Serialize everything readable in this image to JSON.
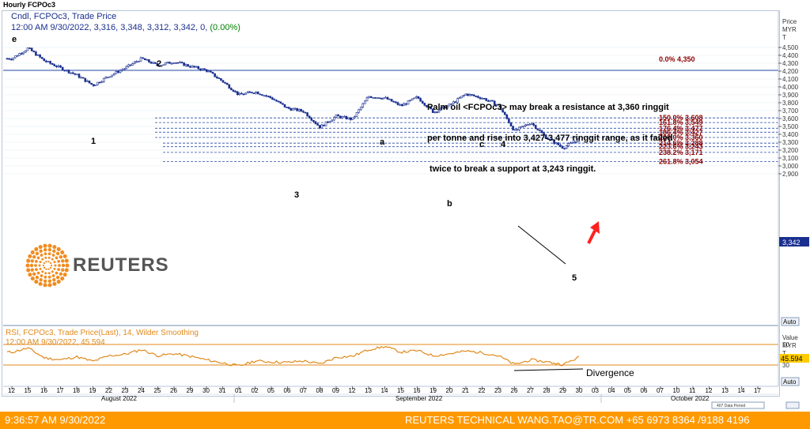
{
  "window": {
    "title": "Hourly FCPOc3"
  },
  "header": {
    "line1": "Cndl, FCPOc3, Trade Price",
    "line2_prefix": "12:00 AM 9/30/2022, 3,316, 3,348, 3,312, 3,342, 0, ",
    "line2_change": "(0.00%)"
  },
  "annotation": {
    "lines": [
      "Palm oil <FCPOc3> may break a resistance at 3,360 ringgit",
      "per tonne and rise into 3,427-3,477 ringgit range, as it failed",
      " twice to break a support at 3,243 ringgit."
    ]
  },
  "price_axis": {
    "title_lines": [
      "Price",
      "MYR",
      "T"
    ],
    "ticks": [
      "4,500",
      "4,400",
      "4,300",
      "4,200",
      "4,100",
      "4,000",
      "3,900",
      "3,800",
      "3,700",
      "3,600",
      "3,500",
      "3,400",
      "3,300",
      "3,200",
      "3,100",
      "3,000",
      "2,900"
    ],
    "current_value": "3,342",
    "auto_label": "Auto"
  },
  "rsi_axis": {
    "title_lines": [
      "Value",
      "MYR",
      "T"
    ],
    "ticks": [
      "70",
      "30"
    ],
    "current_value": "45.594",
    "auto_label": "Auto"
  },
  "rsi_header": {
    "line1": "RSI, FCPOc3, Trade Price(Last),  14, Wilder Smoothing",
    "line2": "12:00 AM 9/30/2022, 45.594"
  },
  "date_axis": {
    "days": [
      "12",
      "15",
      "16",
      "17",
      "18",
      "19",
      "22",
      "23",
      "24",
      "25",
      "26",
      "29",
      "30",
      "31",
      "01",
      "02",
      "05",
      "06",
      "07",
      "08",
      "09",
      "12",
      "13",
      "14",
      "15",
      "16",
      "19",
      "20",
      "21",
      "22",
      "23",
      "26",
      "27",
      "28",
      "29",
      "30",
      "03",
      "04",
      "05",
      "06",
      "07",
      "10",
      "11",
      "12",
      "13",
      "14",
      "17"
    ],
    "months": [
      "August 2022",
      "September 2022",
      "October 2022"
    ],
    "periods_label": "407 Data Period"
  },
  "waves": [
    "e",
    "2",
    "1",
    "3",
    "a",
    "b",
    "c",
    "4",
    "5"
  ],
  "divergence_label": "Divergence",
  "fib_levels": [
    {
      "label": "0.0%",
      "value": "4,350"
    },
    {
      "label": "150.0%",
      "value": "3,608"
    },
    {
      "label": "161.8%",
      "value": "3,549"
    },
    {
      "label": "176.4%",
      "value": "3,477"
    },
    {
      "label": "186.4%",
      "value": "3,427"
    },
    {
      "label": "200.0%",
      "value": "3,360"
    },
    {
      "label": "214.6%",
      "value": "3,288"
    },
    {
      "label": "223.6%",
      "value": "3,243"
    },
    {
      "label": "238.2%",
      "value": "3,171"
    },
    {
      "label": "261.8%",
      "value": "3,054"
    }
  ],
  "logo": {
    "text": "REUTERS"
  },
  "footer": {
    "timestamp": "9:36:57 AM 9/30/2022",
    "contact": "REUTERS TECHNICAL  WANG.TAO@TR.COM  +65 6973 8364 /9188 4196"
  },
  "colors": {
    "candle": "#1a2f8f",
    "fib_line": "#2b4fa8",
    "fib_text": "#8b0000",
    "rsi_line": "#e08a1c",
    "arrow": "#ff2020",
    "footer_bg": "#ff9900",
    "change_green": "#008000"
  },
  "chart_data": [
    {
      "type": "candlestick",
      "title": "Hourly FCPOc3",
      "ylabel": "Price MYR T",
      "ylim": [
        2850,
        4580
      ],
      "x_range": [
        "2022-08-12",
        "2022-10-17"
      ],
      "path_points": [
        {
          "date": "2022-08-12",
          "price": 4360
        },
        {
          "date": "2022-08-15",
          "price": 4490
        },
        {
          "date": "2022-08-16",
          "price": 4330
        },
        {
          "date": "2022-08-17",
          "price": 4240
        },
        {
          "date": "2022-08-18",
          "price": 4150
        },
        {
          "date": "2022-08-19",
          "price": 4020
        },
        {
          "date": "2022-08-22",
          "price": 4140
        },
        {
          "date": "2022-08-23",
          "price": 4240
        },
        {
          "date": "2022-08-24",
          "price": 4360
        },
        {
          "date": "2022-08-25",
          "price": 4270
        },
        {
          "date": "2022-08-26",
          "price": 4320
        },
        {
          "date": "2022-08-29",
          "price": 4260
        },
        {
          "date": "2022-08-30",
          "price": 4210
        },
        {
          "date": "2022-08-31",
          "price": 4070
        },
        {
          "date": "2022-09-01",
          "price": 3900
        },
        {
          "date": "2022-09-02",
          "price": 3940
        },
        {
          "date": "2022-09-05",
          "price": 3860
        },
        {
          "date": "2022-09-06",
          "price": 3730
        },
        {
          "date": "2022-09-07",
          "price": 3690
        },
        {
          "date": "2022-09-08",
          "price": 3490
        },
        {
          "date": "2022-09-09",
          "price": 3630
        },
        {
          "date": "2022-09-12",
          "price": 3590
        },
        {
          "date": "2022-09-13",
          "price": 3880
        },
        {
          "date": "2022-09-14",
          "price": 3860
        },
        {
          "date": "2022-09-15",
          "price": 3760
        },
        {
          "date": "2022-09-16",
          "price": 3870
        },
        {
          "date": "2022-09-19",
          "price": 3680
        },
        {
          "date": "2022-09-20",
          "price": 3770
        },
        {
          "date": "2022-09-21",
          "price": 3910
        },
        {
          "date": "2022-09-22",
          "price": 3860
        },
        {
          "date": "2022-09-23",
          "price": 3770
        },
        {
          "date": "2022-09-26",
          "price": 3440
        },
        {
          "date": "2022-09-27",
          "price": 3550
        },
        {
          "date": "2022-09-28",
          "price": 3350
        },
        {
          "date": "2022-09-29",
          "price": 3230
        },
        {
          "date": "2022-09-30",
          "price": 3342
        }
      ]
    },
    {
      "type": "line",
      "title": "RSI, FCPOc3, Trade Price(Last),  14, Wilder Smoothing",
      "ylim": [
        10,
        90
      ],
      "levels": [
        70,
        30
      ],
      "points": [
        {
          "date": "2022-08-12",
          "rsi": 55
        },
        {
          "date": "2022-08-15",
          "rsi": 63
        },
        {
          "date": "2022-08-16",
          "rsi": 44
        },
        {
          "date": "2022-08-17",
          "rsi": 40
        },
        {
          "date": "2022-08-18",
          "rsi": 46
        },
        {
          "date": "2022-08-19",
          "rsi": 37
        },
        {
          "date": "2022-08-22",
          "rsi": 48
        },
        {
          "date": "2022-08-23",
          "rsi": 51
        },
        {
          "date": "2022-08-24",
          "rsi": 60
        },
        {
          "date": "2022-08-25",
          "rsi": 48
        },
        {
          "date": "2022-08-26",
          "rsi": 52
        },
        {
          "date": "2022-08-29",
          "rsi": 47
        },
        {
          "date": "2022-08-30",
          "rsi": 40
        },
        {
          "date": "2022-08-31",
          "rsi": 34
        },
        {
          "date": "2022-09-01",
          "rsi": 28
        },
        {
          "date": "2022-09-02",
          "rsi": 38
        },
        {
          "date": "2022-09-05",
          "rsi": 36
        },
        {
          "date": "2022-09-06",
          "rsi": 35
        },
        {
          "date": "2022-09-07",
          "rsi": 38
        },
        {
          "date": "2022-09-08",
          "rsi": 32
        },
        {
          "date": "2022-09-09",
          "rsi": 45
        },
        {
          "date": "2022-09-12",
          "rsi": 47
        },
        {
          "date": "2022-09-13",
          "rsi": 60
        },
        {
          "date": "2022-09-14",
          "rsi": 66
        },
        {
          "date": "2022-09-15",
          "rsi": 55
        },
        {
          "date": "2022-09-16",
          "rsi": 58
        },
        {
          "date": "2022-09-19",
          "rsi": 48
        },
        {
          "date": "2022-09-20",
          "rsi": 52
        },
        {
          "date": "2022-09-21",
          "rsi": 57
        },
        {
          "date": "2022-09-22",
          "rsi": 54
        },
        {
          "date": "2022-09-23",
          "rsi": 48
        },
        {
          "date": "2022-09-26",
          "rsi": 31
        },
        {
          "date": "2022-09-27",
          "rsi": 40
        },
        {
          "date": "2022-09-28",
          "rsi": 36
        },
        {
          "date": "2022-09-29",
          "rsi": 31
        },
        {
          "date": "2022-09-30",
          "rsi": 45.594
        }
      ]
    }
  ]
}
